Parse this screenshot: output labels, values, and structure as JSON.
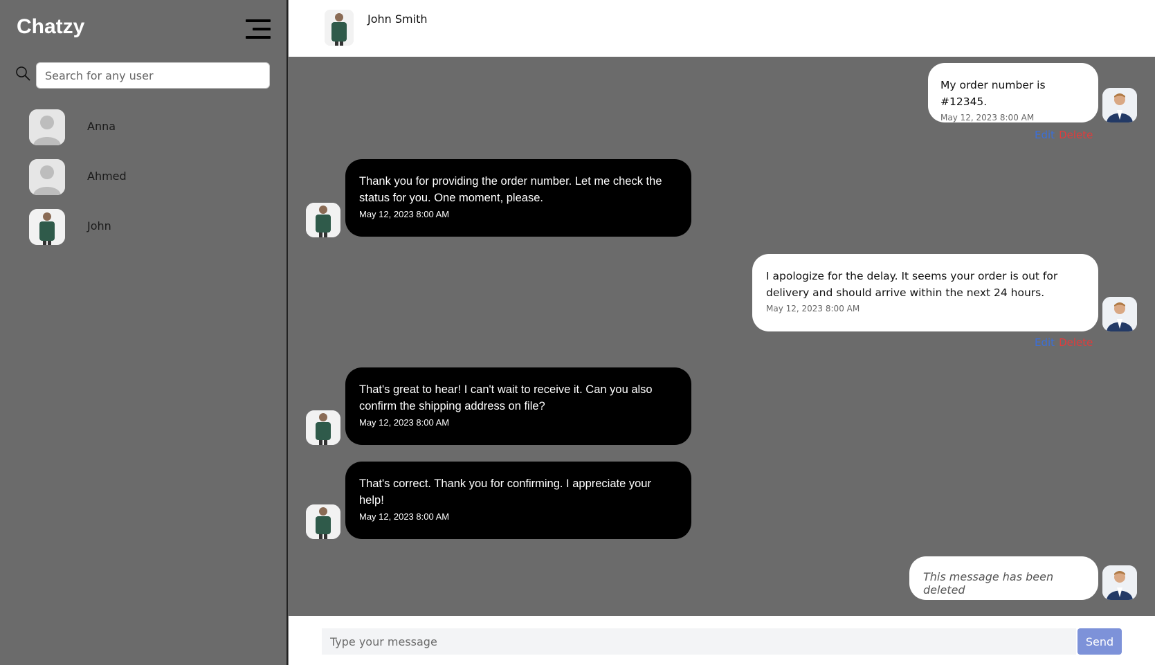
{
  "app": {
    "title": "Chatzy"
  },
  "search": {
    "placeholder": "Search for any user"
  },
  "users": [
    {
      "name": "Anna",
      "avatar": "default-avatar"
    },
    {
      "name": "Ahmed",
      "avatar": "default-avatar"
    },
    {
      "name": "John",
      "avatar": "john-photo"
    }
  ],
  "chat": {
    "contact_name": "John Smith",
    "messages": [
      {
        "direction": "out",
        "text": "My order number is #12345.",
        "time": "May 12, 2023 8:00 AM",
        "actions": true
      },
      {
        "direction": "in",
        "text": "Thank you for providing the order number. Let me check the status for you. One moment, please.",
        "time": "May 12, 2023 8:00 AM"
      },
      {
        "direction": "out",
        "text": "I apologize for the delay. It seems your order is out for delivery and should arrive within the next 24 hours.",
        "time": "May 12, 2023 8:00 AM",
        "actions": true
      },
      {
        "direction": "in",
        "text": "That's great to hear! I can't wait to receive it. Can you also confirm the shipping address on file?",
        "time": "May 12, 2023 8:00 AM"
      },
      {
        "direction": "in",
        "text": "That's correct. Thank you for confirming. I appreciate your help!",
        "time": "May 12, 2023 8:00 AM"
      },
      {
        "direction": "out",
        "text": "This message has been deleted",
        "deleted": true
      }
    ],
    "edit_label": "Edit",
    "delete_label": "Delete"
  },
  "composer": {
    "placeholder": "Type your message",
    "send_label": "Send"
  },
  "colors": {
    "sidebar_bg": "#6b6b6b",
    "send_button": "#7d92d9",
    "edit": "#3b6fd8",
    "delete": "#e23b3b"
  }
}
